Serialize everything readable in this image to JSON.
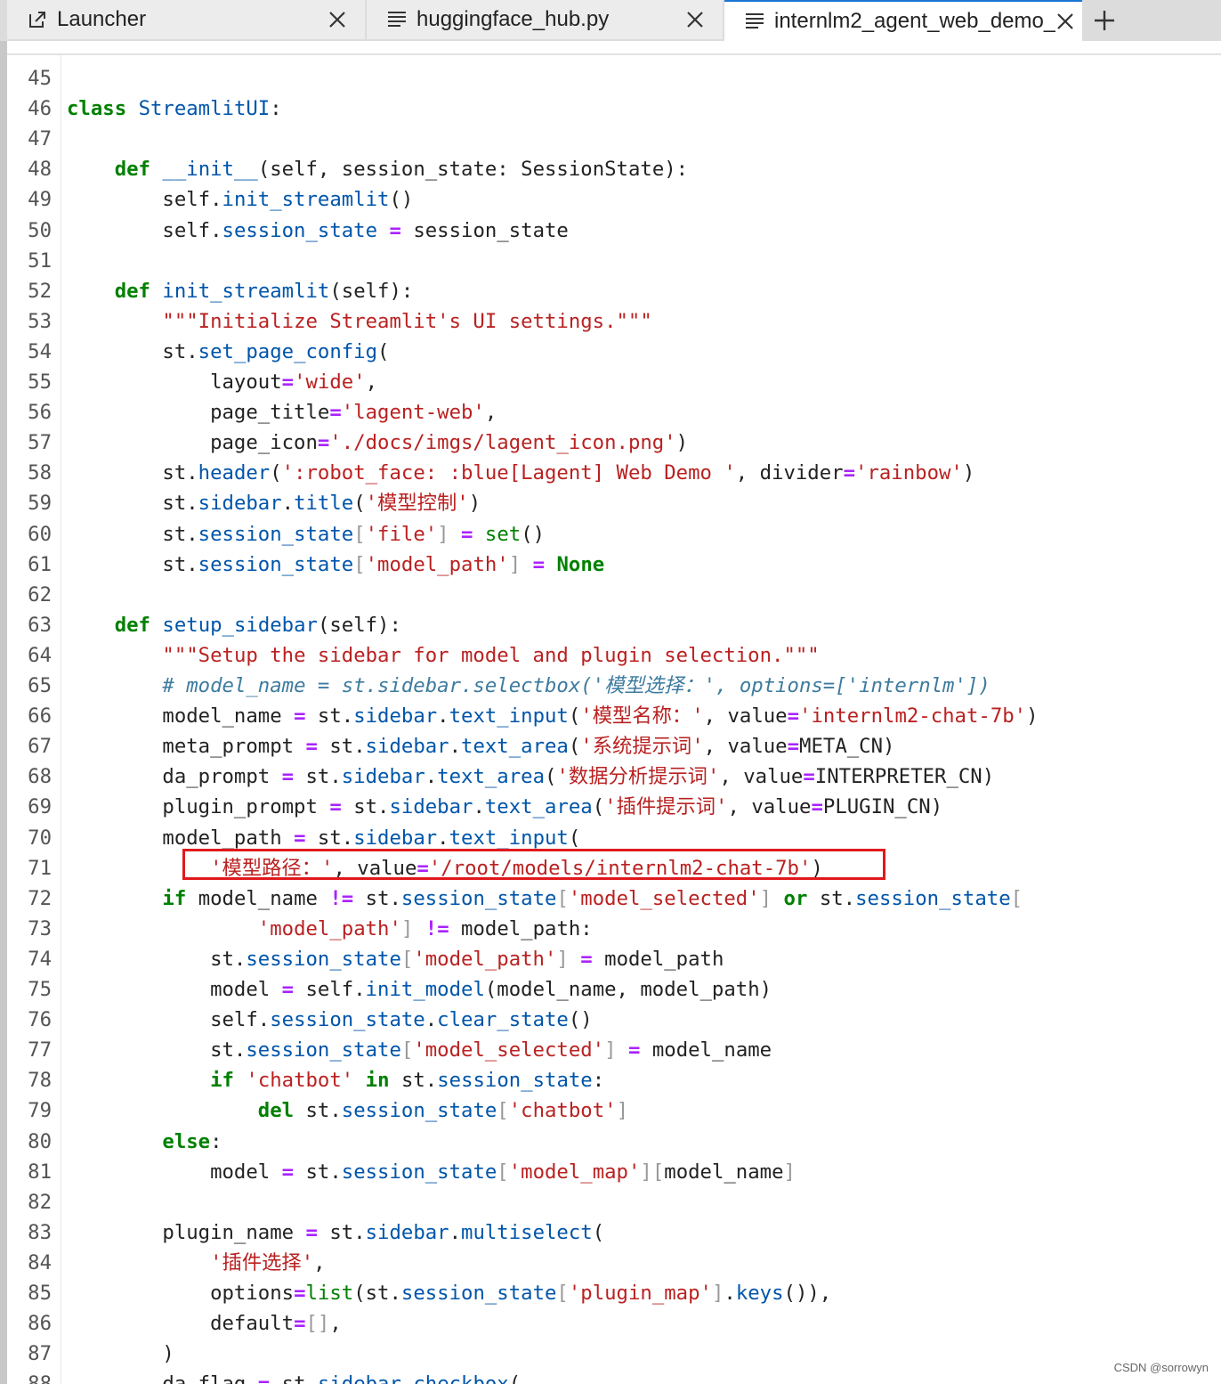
{
  "tabs": [
    {
      "label": "Launcher",
      "icon": "launcher-icon"
    },
    {
      "label": "huggingface_hub.py",
      "icon": "file-text-icon"
    },
    {
      "label": "internlm2_agent_web_demo_",
      "icon": "file-text-icon"
    }
  ],
  "active_tab": 2,
  "new_tab_icon": "plus-icon",
  "watermark": "CSDN @sorrowyn",
  "editor": {
    "highlight_line": 71,
    "lines": [
      {
        "n": "45",
        "tokens": []
      },
      {
        "n": "46",
        "tokens": [
          [
            "k",
            "class"
          ],
          [
            "",
            ""
          ],
          [
            "",
            " "
          ],
          [
            "f",
            "StreamlitUI"
          ],
          [
            "",
            ":"
          ]
        ]
      },
      {
        "n": "47",
        "tokens": []
      },
      {
        "n": "48",
        "tokens": [
          [
            "",
            "    "
          ],
          [
            "k",
            "def"
          ],
          [
            "",
            " "
          ],
          [
            "f",
            "__init__"
          ],
          [
            "",
            "(self, session_state: SessionState):"
          ]
        ]
      },
      {
        "n": "49",
        "tokens": [
          [
            "",
            "        self."
          ],
          [
            "f",
            "init_streamlit"
          ],
          [
            "",
            "()"
          ]
        ]
      },
      {
        "n": "50",
        "tokens": [
          [
            "",
            "        self."
          ],
          [
            "f",
            "session_state"
          ],
          [
            "",
            " "
          ],
          [
            "o",
            "="
          ],
          [
            "",
            " session_state"
          ]
        ]
      },
      {
        "n": "51",
        "tokens": []
      },
      {
        "n": "52",
        "tokens": [
          [
            "",
            "    "
          ],
          [
            "k",
            "def"
          ],
          [
            "",
            " "
          ],
          [
            "f",
            "init_streamlit"
          ],
          [
            "",
            "(self):"
          ]
        ]
      },
      {
        "n": "53",
        "tokens": [
          [
            "",
            "        "
          ],
          [
            "s",
            "\"\"\"Initialize Streamlit's UI settings.\"\"\""
          ]
        ]
      },
      {
        "n": "54",
        "tokens": [
          [
            "",
            "        st."
          ],
          [
            "f",
            "set_page_config"
          ],
          [
            "",
            "("
          ]
        ]
      },
      {
        "n": "55",
        "tokens": [
          [
            "",
            "            layout"
          ],
          [
            "o",
            "="
          ],
          [
            "s",
            "'wide'"
          ],
          [
            "",
            ","
          ]
        ]
      },
      {
        "n": "56",
        "tokens": [
          [
            "",
            "            page_title"
          ],
          [
            "o",
            "="
          ],
          [
            "s",
            "'lagent-web'"
          ],
          [
            "",
            ","
          ]
        ]
      },
      {
        "n": "57",
        "tokens": [
          [
            "",
            "            page_icon"
          ],
          [
            "o",
            "="
          ],
          [
            "s",
            "'./docs/imgs/lagent_icon.png'"
          ],
          [
            "",
            ")"
          ]
        ]
      },
      {
        "n": "58",
        "tokens": [
          [
            "",
            "        st."
          ],
          [
            "f",
            "header"
          ],
          [
            "",
            "("
          ],
          [
            "s",
            "':robot_face: :blue[Lagent] Web Demo '"
          ],
          [
            "",
            ", divider"
          ],
          [
            "o",
            "="
          ],
          [
            "s",
            "'rainbow'"
          ],
          [
            "",
            ")"
          ]
        ]
      },
      {
        "n": "59",
        "tokens": [
          [
            "",
            "        st."
          ],
          [
            "f",
            "sidebar"
          ],
          [
            "",
            "."
          ],
          [
            "f",
            "title"
          ],
          [
            "",
            "("
          ],
          [
            "s",
            "'模型控制'"
          ],
          [
            "",
            ")"
          ]
        ]
      },
      {
        "n": "60",
        "tokens": [
          [
            "",
            "        st."
          ],
          [
            "f",
            "session_state"
          ],
          [
            "p",
            "["
          ],
          [
            "s",
            "'file'"
          ],
          [
            "p",
            "]"
          ],
          [
            "",
            " "
          ],
          [
            "o",
            "="
          ],
          [
            "",
            " "
          ],
          [
            "b",
            "set"
          ],
          [
            "",
            "()"
          ]
        ]
      },
      {
        "n": "61",
        "tokens": [
          [
            "",
            "        st."
          ],
          [
            "f",
            "session_state"
          ],
          [
            "p",
            "["
          ],
          [
            "s",
            "'model_path'"
          ],
          [
            "p",
            "]"
          ],
          [
            "",
            " "
          ],
          [
            "o",
            "="
          ],
          [
            "",
            " "
          ],
          [
            "k",
            "None"
          ]
        ]
      },
      {
        "n": "62",
        "tokens": []
      },
      {
        "n": "63",
        "tokens": [
          [
            "",
            "    "
          ],
          [
            "k",
            "def"
          ],
          [
            "",
            " "
          ],
          [
            "f",
            "setup_sidebar"
          ],
          [
            "",
            "(self):"
          ]
        ]
      },
      {
        "n": "64",
        "tokens": [
          [
            "",
            "        "
          ],
          [
            "s",
            "\"\"\"Setup the sidebar for model and plugin selection.\"\"\""
          ]
        ]
      },
      {
        "n": "65",
        "tokens": [
          [
            "",
            "        "
          ],
          [
            "c",
            "# model_name = st.sidebar.selectbox('模型选择：', options=['internlm'])"
          ]
        ]
      },
      {
        "n": "66",
        "tokens": [
          [
            "",
            "        model_name "
          ],
          [
            "o",
            "="
          ],
          [
            "",
            " st."
          ],
          [
            "f",
            "sidebar"
          ],
          [
            "",
            "."
          ],
          [
            "f",
            "text_input"
          ],
          [
            "",
            "("
          ],
          [
            "s",
            "'模型名称：'"
          ],
          [
            "",
            ", value"
          ],
          [
            "o",
            "="
          ],
          [
            "s",
            "'internlm2-chat-7b'"
          ],
          [
            "",
            ")"
          ]
        ]
      },
      {
        "n": "67",
        "tokens": [
          [
            "",
            "        meta_prompt "
          ],
          [
            "o",
            "="
          ],
          [
            "",
            " st."
          ],
          [
            "f",
            "sidebar"
          ],
          [
            "",
            "."
          ],
          [
            "f",
            "text_area"
          ],
          [
            "",
            "("
          ],
          [
            "s",
            "'系统提示词'"
          ],
          [
            "",
            ", value"
          ],
          [
            "o",
            "="
          ],
          [
            "",
            "META_CN)"
          ]
        ]
      },
      {
        "n": "68",
        "tokens": [
          [
            "",
            "        da_prompt "
          ],
          [
            "o",
            "="
          ],
          [
            "",
            " st."
          ],
          [
            "f",
            "sidebar"
          ],
          [
            "",
            "."
          ],
          [
            "f",
            "text_area"
          ],
          [
            "",
            "("
          ],
          [
            "s",
            "'数据分析提示词'"
          ],
          [
            "",
            ", value"
          ],
          [
            "o",
            "="
          ],
          [
            "",
            "INTERPRETER_CN)"
          ]
        ]
      },
      {
        "n": "69",
        "tokens": [
          [
            "",
            "        plugin_prompt "
          ],
          [
            "o",
            "="
          ],
          [
            "",
            " st."
          ],
          [
            "f",
            "sidebar"
          ],
          [
            "",
            "."
          ],
          [
            "f",
            "text_area"
          ],
          [
            "",
            "("
          ],
          [
            "s",
            "'插件提示词'"
          ],
          [
            "",
            ", value"
          ],
          [
            "o",
            "="
          ],
          [
            "",
            "PLUGIN_CN)"
          ]
        ]
      },
      {
        "n": "70",
        "tokens": [
          [
            "",
            "        model_path "
          ],
          [
            "o",
            "="
          ],
          [
            "",
            " st."
          ],
          [
            "f",
            "sidebar"
          ],
          [
            "",
            "."
          ],
          [
            "f",
            "text_input"
          ],
          [
            "",
            "("
          ]
        ]
      },
      {
        "n": "71",
        "tokens": [
          [
            "",
            "            "
          ],
          [
            "s",
            "'模型路径：'"
          ],
          [
            "",
            ", value"
          ],
          [
            "o",
            "="
          ],
          [
            "s",
            "'/root/models/internlm2-chat-7b'"
          ],
          [
            "",
            ")"
          ]
        ]
      },
      {
        "n": "72",
        "tokens": [
          [
            "",
            "        "
          ],
          [
            "k",
            "if"
          ],
          [
            "",
            " model_name "
          ],
          [
            "o",
            "!="
          ],
          [
            "",
            " st."
          ],
          [
            "f",
            "session_state"
          ],
          [
            "p",
            "["
          ],
          [
            "s",
            "'model_selected'"
          ],
          [
            "p",
            "]"
          ],
          [
            "",
            " "
          ],
          [
            "k",
            "or"
          ],
          [
            "",
            " st."
          ],
          [
            "f",
            "session_state"
          ],
          [
            "p",
            "["
          ]
        ]
      },
      {
        "n": "73",
        "tokens": [
          [
            "",
            "                "
          ],
          [
            "s",
            "'model_path'"
          ],
          [
            "p",
            "]"
          ],
          [
            "",
            " "
          ],
          [
            "o",
            "!="
          ],
          [
            "",
            " model_path:"
          ]
        ]
      },
      {
        "n": "74",
        "tokens": [
          [
            "",
            "            st."
          ],
          [
            "f",
            "session_state"
          ],
          [
            "p",
            "["
          ],
          [
            "s",
            "'model_path'"
          ],
          [
            "p",
            "]"
          ],
          [
            "",
            " "
          ],
          [
            "o",
            "="
          ],
          [
            "",
            " model_path"
          ]
        ]
      },
      {
        "n": "75",
        "tokens": [
          [
            "",
            "            model "
          ],
          [
            "o",
            "="
          ],
          [
            "",
            " self."
          ],
          [
            "f",
            "init_model"
          ],
          [
            "",
            "(model_name, model_path)"
          ]
        ]
      },
      {
        "n": "76",
        "tokens": [
          [
            "",
            "            self."
          ],
          [
            "f",
            "session_state"
          ],
          [
            "",
            "."
          ],
          [
            "f",
            "clear_state"
          ],
          [
            "",
            "()"
          ]
        ]
      },
      {
        "n": "77",
        "tokens": [
          [
            "",
            "            st."
          ],
          [
            "f",
            "session_state"
          ],
          [
            "p",
            "["
          ],
          [
            "s",
            "'model_selected'"
          ],
          [
            "p",
            "]"
          ],
          [
            "",
            " "
          ],
          [
            "o",
            "="
          ],
          [
            "",
            " model_name"
          ]
        ]
      },
      {
        "n": "78",
        "tokens": [
          [
            "",
            "            "
          ],
          [
            "k",
            "if"
          ],
          [
            "",
            " "
          ],
          [
            "s",
            "'chatbot'"
          ],
          [
            "",
            " "
          ],
          [
            "k",
            "in"
          ],
          [
            "",
            " st."
          ],
          [
            "f",
            "session_state"
          ],
          [
            "",
            ":"
          ]
        ]
      },
      {
        "n": "79",
        "tokens": [
          [
            "",
            "                "
          ],
          [
            "k",
            "del"
          ],
          [
            "",
            " st."
          ],
          [
            "f",
            "session_state"
          ],
          [
            "p",
            "["
          ],
          [
            "s",
            "'chatbot'"
          ],
          [
            "p",
            "]"
          ]
        ]
      },
      {
        "n": "80",
        "tokens": [
          [
            "",
            "        "
          ],
          [
            "k",
            "else"
          ],
          [
            "",
            ":"
          ]
        ]
      },
      {
        "n": "81",
        "tokens": [
          [
            "",
            "            model "
          ],
          [
            "o",
            "="
          ],
          [
            "",
            " st."
          ],
          [
            "f",
            "session_state"
          ],
          [
            "p",
            "["
          ],
          [
            "s",
            "'model_map'"
          ],
          [
            "p",
            "]["
          ],
          [
            "",
            "model_name"
          ],
          [
            "p",
            "]"
          ]
        ]
      },
      {
        "n": "82",
        "tokens": []
      },
      {
        "n": "83",
        "tokens": [
          [
            "",
            "        plugin_name "
          ],
          [
            "o",
            "="
          ],
          [
            "",
            " st."
          ],
          [
            "f",
            "sidebar"
          ],
          [
            "",
            "."
          ],
          [
            "f",
            "multiselect"
          ],
          [
            "",
            "("
          ]
        ]
      },
      {
        "n": "84",
        "tokens": [
          [
            "",
            "            "
          ],
          [
            "s",
            "'插件选择'"
          ],
          [
            "",
            ","
          ]
        ]
      },
      {
        "n": "85",
        "tokens": [
          [
            "",
            "            options"
          ],
          [
            "o",
            "="
          ],
          [
            "b",
            "list"
          ],
          [
            "",
            "(st."
          ],
          [
            "f",
            "session_state"
          ],
          [
            "p",
            "["
          ],
          [
            "s",
            "'plugin_map'"
          ],
          [
            "p",
            "]"
          ],
          [
            "",
            "."
          ],
          [
            "f",
            "keys"
          ],
          [
            "",
            "()),"
          ]
        ]
      },
      {
        "n": "86",
        "tokens": [
          [
            "",
            "            default"
          ],
          [
            "o",
            "="
          ],
          [
            "p",
            "[]"
          ],
          [
            "",
            ","
          ]
        ]
      },
      {
        "n": "87",
        "tokens": [
          [
            "",
            "        )"
          ]
        ]
      },
      {
        "n": "88",
        "tokens": [
          [
            "",
            "        da_flag "
          ],
          [
            "o",
            "="
          ],
          [
            "",
            " st."
          ],
          [
            "f",
            "sidebar"
          ],
          [
            "",
            "."
          ],
          [
            "f",
            "checkbox"
          ],
          [
            "",
            "("
          ]
        ]
      }
    ]
  }
}
